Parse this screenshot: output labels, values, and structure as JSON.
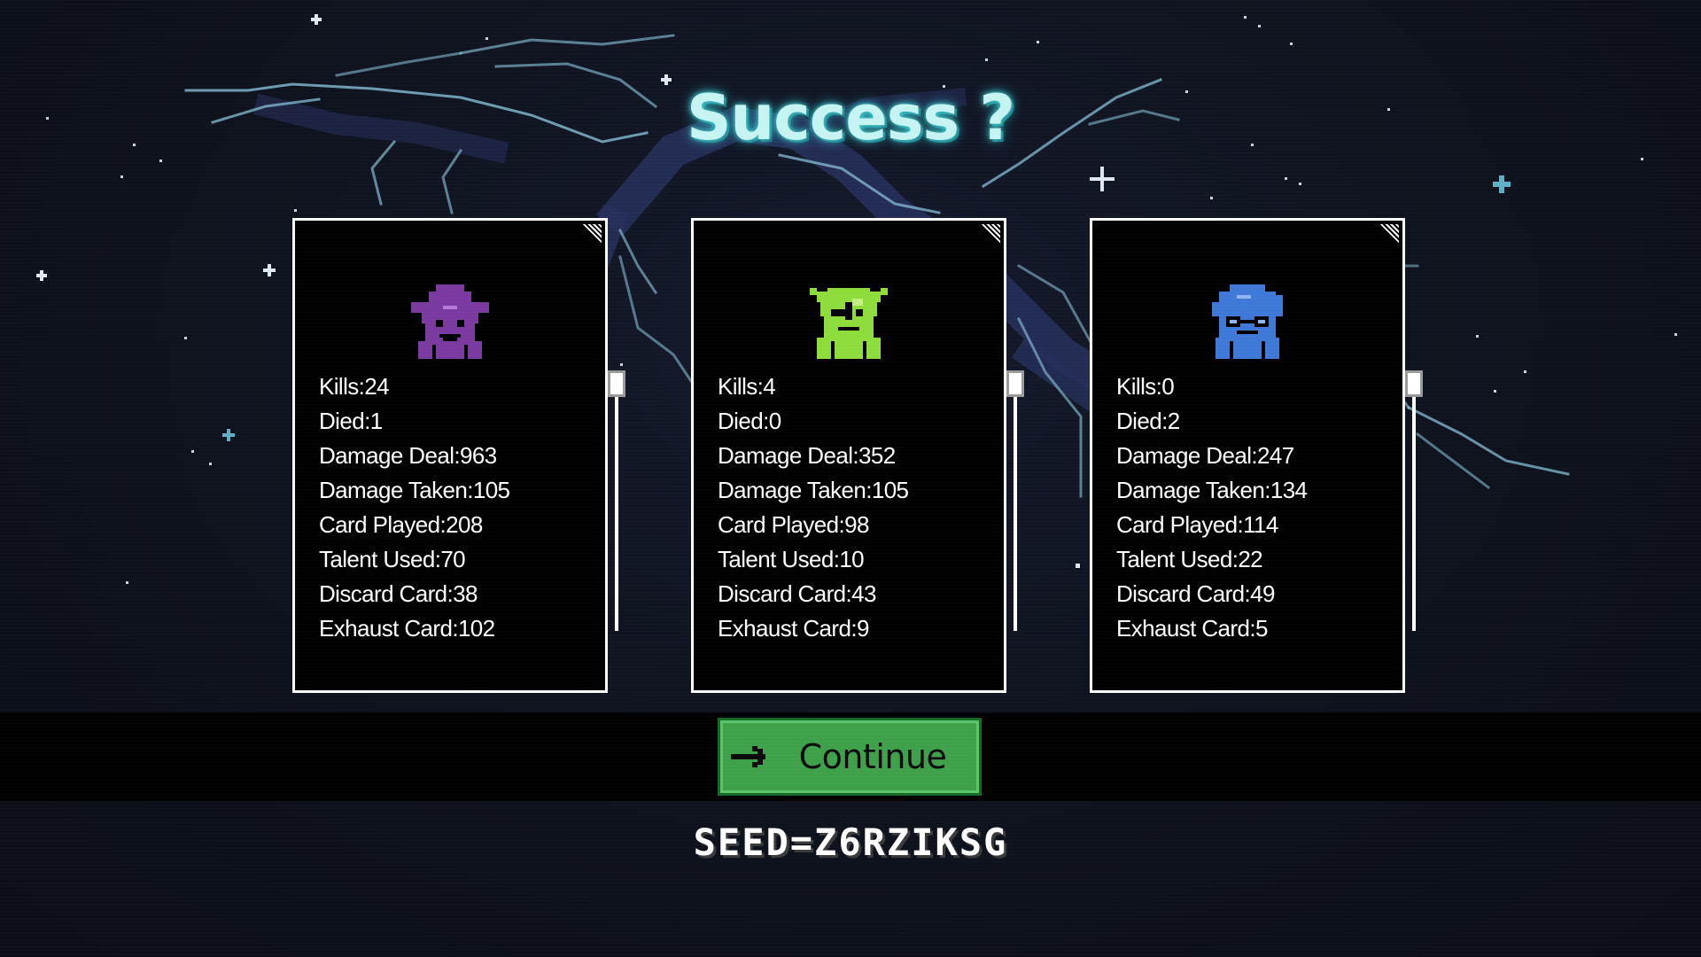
{
  "screen": {
    "title": "Success ?",
    "continue_label": "Continue",
    "seed": "SEED=Z6RZIKSG"
  },
  "colors": {
    "background": "#0d1019",
    "branch": "#8cc8e0",
    "title_glow": "#4fd6d6",
    "continue_green": "#3ea14a",
    "witch_purple": "#7a3aa0",
    "goblin_green": "#8edc3c",
    "mage_blue": "#3f79d8"
  },
  "characters": [
    {
      "avatar_icon": "purple-witch-hat-icon",
      "stats": {
        "kills": "Kills:24",
        "died": "Died:1",
        "damage_deal": "Damage Deal:963",
        "damage_taken": "Damage Taken:105",
        "card_played": "Card Played:208",
        "talent_used": "Talent Used:70",
        "discard_card": "Discard Card:38",
        "exhaust_card": "Exhaust Card:102"
      }
    },
    {
      "avatar_icon": "green-goblin-icon",
      "stats": {
        "kills": "Kills:4",
        "died": "Died:0",
        "damage_deal": "Damage Deal:352",
        "damage_taken": "Damage Taken:105",
        "card_played": "Card Played:98",
        "talent_used": "Talent Used:10",
        "discard_card": "Discard Card:43",
        "exhaust_card": "Exhaust Card:9"
      }
    },
    {
      "avatar_icon": "blue-mage-icon",
      "stats": {
        "kills": "Kills:0",
        "died": "Died:2",
        "damage_deal": "Damage Deal:247",
        "damage_taken": "Damage Taken:134",
        "card_played": "Card Played:114",
        "talent_used": "Talent Used:22",
        "discard_card": "Discard Card:49",
        "exhaust_card": "Exhaust Card:5"
      }
    }
  ]
}
